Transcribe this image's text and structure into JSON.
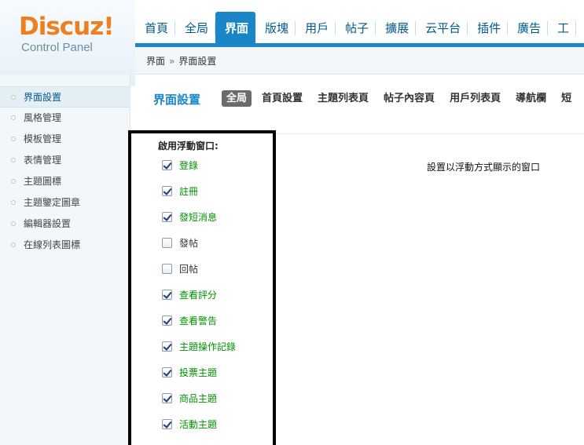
{
  "logo": {
    "word": "Discuz",
    "bang": "!",
    "subtitle": "Control Panel",
    "word_color": "#ef7e1e",
    "bang_color": "#ef7e1e"
  },
  "topnav": {
    "items": [
      {
        "label": "首頁",
        "active": false
      },
      {
        "label": "全局",
        "active": false
      },
      {
        "label": "界面",
        "active": true
      },
      {
        "label": "版塊",
        "active": false
      },
      {
        "label": "用戶",
        "active": false
      },
      {
        "label": "帖子",
        "active": false
      },
      {
        "label": "擴展",
        "active": false
      },
      {
        "label": "云平台",
        "active": false
      },
      {
        "label": "插件",
        "active": false
      },
      {
        "label": "廣告",
        "active": false
      },
      {
        "label": "工",
        "active": false
      }
    ],
    "accent_color": "#1a86c8"
  },
  "breadcrumb": {
    "root": "界面",
    "separator": "»",
    "current": "界面設置"
  },
  "sidebar": {
    "items": [
      {
        "label": "界面設置",
        "active": true
      },
      {
        "label": "風格管理",
        "active": false
      },
      {
        "label": "模板管理",
        "active": false
      },
      {
        "label": "表情管理",
        "active": false
      },
      {
        "label": "主題圖標",
        "active": false
      },
      {
        "label": "主題鑒定圖章",
        "active": false
      },
      {
        "label": "編輯器設置",
        "active": false
      },
      {
        "label": "在線列表圖標",
        "active": false
      }
    ]
  },
  "main": {
    "title": "界面設置",
    "tabs": [
      {
        "label": "全局",
        "active": true
      },
      {
        "label": "首頁設置",
        "active": false
      },
      {
        "label": "主題列表頁",
        "active": false
      },
      {
        "label": "帖子內容頁",
        "active": false
      },
      {
        "label": "用戶列表頁",
        "active": false
      },
      {
        "label": "導航欄",
        "active": false
      },
      {
        "label": "短",
        "active": false
      }
    ]
  },
  "floating_windows": {
    "label": "啟用浮動窗口:",
    "description": "設置以浮動方式顯示的窗口",
    "options": [
      {
        "label": "登錄",
        "checked": true
      },
      {
        "label": "註冊",
        "checked": true
      },
      {
        "label": "發短消息",
        "checked": true
      },
      {
        "label": "發帖",
        "checked": false
      },
      {
        "label": "回帖",
        "checked": false
      },
      {
        "label": "查看評分",
        "checked": true
      },
      {
        "label": "查看警告",
        "checked": true
      },
      {
        "label": "主題操作記錄",
        "checked": true
      },
      {
        "label": "投票主題",
        "checked": true
      },
      {
        "label": "商品主題",
        "checked": true
      },
      {
        "label": "活動主題",
        "checked": true
      }
    ],
    "checked_text_color": "#009100"
  }
}
